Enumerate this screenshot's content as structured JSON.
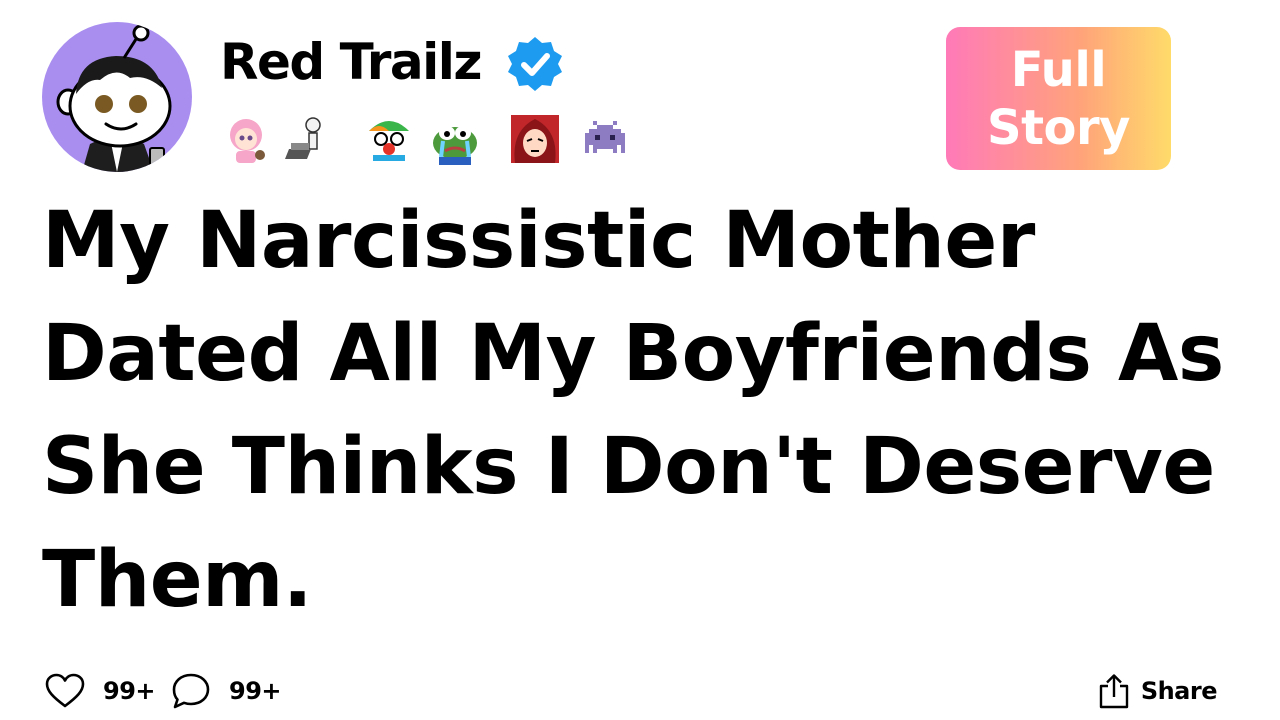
{
  "post": {
    "author": {
      "name": "Red Trailz",
      "verified": true,
      "avatar_icon": "reddit-snoo-avatar-icon",
      "avatar_bg": "#a98ef0",
      "verified_color": "#1d9bf0"
    },
    "badges": [
      {
        "icon": "anime-girl-badge-icon"
      },
      {
        "icon": "skeleton-laptop-badge-icon"
      },
      {
        "icon": "clown-badge-icon"
      },
      {
        "icon": "crying-frog-badge-icon"
      },
      {
        "icon": "red-hair-girl-badge-icon"
      },
      {
        "icon": "purple-space-invader-badge-icon"
      }
    ],
    "cta": {
      "line1": "Full",
      "line2": "Story",
      "gradient": [
        "#ff7ab8",
        "#ffa37a",
        "#ffdb6a"
      ]
    },
    "title_lines": [
      "My Narcissistic Mother",
      "Dated All My Boyfriends As",
      "She Thinks I Don't Deserve",
      "Them."
    ],
    "footer": {
      "likes": "99+",
      "comments": "99+",
      "share_label": "Share"
    }
  }
}
